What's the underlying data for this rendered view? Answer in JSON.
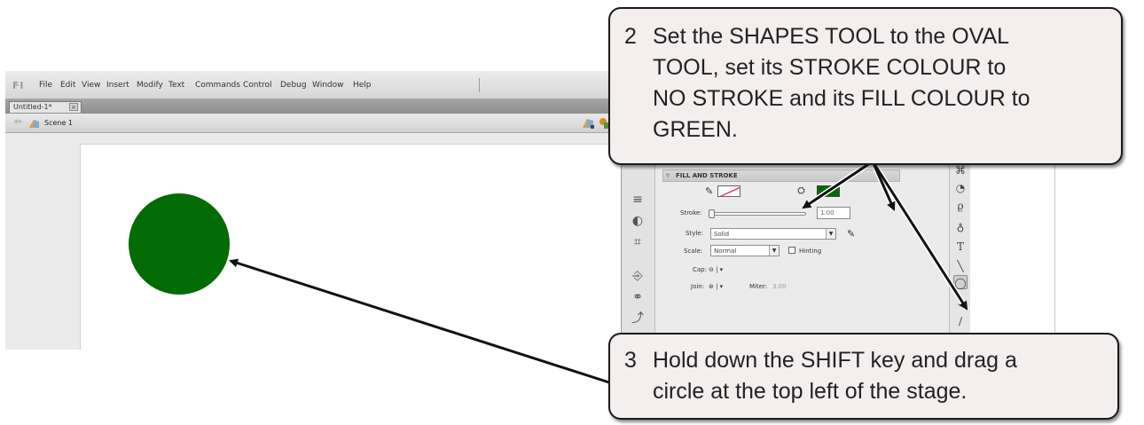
{
  "app": {
    "logo": "Fl",
    "menu": [
      "File",
      "Edit",
      "View",
      "Insert",
      "Modify",
      "Text",
      "Commands",
      "Control",
      "Debug",
      "Window",
      "Help"
    ],
    "document_tab": "Untitled-1*",
    "tab_close": "×",
    "scene_label": "Scene 1"
  },
  "properties": {
    "section_title": "FILL AND STROKE",
    "stroke_label": "Stroke:",
    "stroke_value": "1.00",
    "style_label": "Style:",
    "style_value": "Solid",
    "scale_label": "Scale:",
    "scale_value": "Normal",
    "hinting_label": "Hinting",
    "cap_label": "Cap:",
    "join_label": "Join:",
    "miter_label": "Miter:",
    "miter_value": "3.00",
    "fill_color": "#036b03"
  },
  "callouts": [
    {
      "number": "2",
      "lines": [
        "Set the SHAPES TOOL to the OVAL",
        "TOOL, set its STROKE COLOUR to",
        "NO STROKE and its FILL COLOUR to",
        "GREEN."
      ]
    },
    {
      "number": "3",
      "lines": [
        "Hold down the SHIFT key and drag a",
        "circle at the top left of the stage."
      ]
    }
  ],
  "colors": {
    "circle": "#036b03",
    "callout_bg": "#f4eeee"
  }
}
